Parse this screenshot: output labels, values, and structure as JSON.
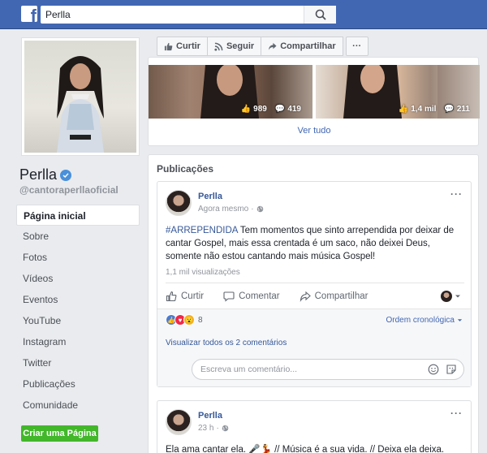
{
  "search": {
    "value": "Perlla"
  },
  "profile": {
    "name": "Perlla",
    "handle": "@cantoraperllaoficial"
  },
  "nav": {
    "items": [
      {
        "label": "Página inicial",
        "active": true
      },
      {
        "label": "Sobre"
      },
      {
        "label": "Fotos"
      },
      {
        "label": "Vídeos"
      },
      {
        "label": "Eventos"
      },
      {
        "label": "YouTube"
      },
      {
        "label": "Instagram"
      },
      {
        "label": "Twitter"
      },
      {
        "label": "Publicações"
      },
      {
        "label": "Comunidade"
      }
    ],
    "create_page": "Criar uma Página"
  },
  "actions": {
    "like": "Curtir",
    "follow": "Seguir",
    "share": "Compartilhar",
    "more": "···"
  },
  "photos": {
    "items": [
      {
        "likes": "989",
        "comments": "419"
      },
      {
        "likes": "1,4 mil",
        "comments": "211"
      }
    ],
    "see_all": "Ver tudo"
  },
  "publications": {
    "title": "Publicações",
    "posts": [
      {
        "author": "Perlla",
        "time": "Agora mesmo",
        "hashtag": "#ARREPENDIDA",
        "text": " Tem momentos que sinto arrependida por deixar de cantar Gospel, mais essa crentada é um saco, não deixei Deus, somente não estou cantando mais música Gospel!",
        "views": "1,1 mil visualizações",
        "like": "Curtir",
        "comment": "Comentar",
        "share": "Compartilhar",
        "reaction_count": "8",
        "order": "Ordem cronológica",
        "view_comments": "Visualizar todos os 2 comentários",
        "comment_placeholder": "Escreva um comentário..."
      },
      {
        "author": "Perlla",
        "time": "23 h",
        "text": "Ela ama cantar ela. 🎤💃 // Música é a sua vida. // Deixa ela deixa."
      }
    ]
  },
  "colors": {
    "brand": "#4267b2",
    "link": "#365899",
    "green": "#42b72a"
  }
}
